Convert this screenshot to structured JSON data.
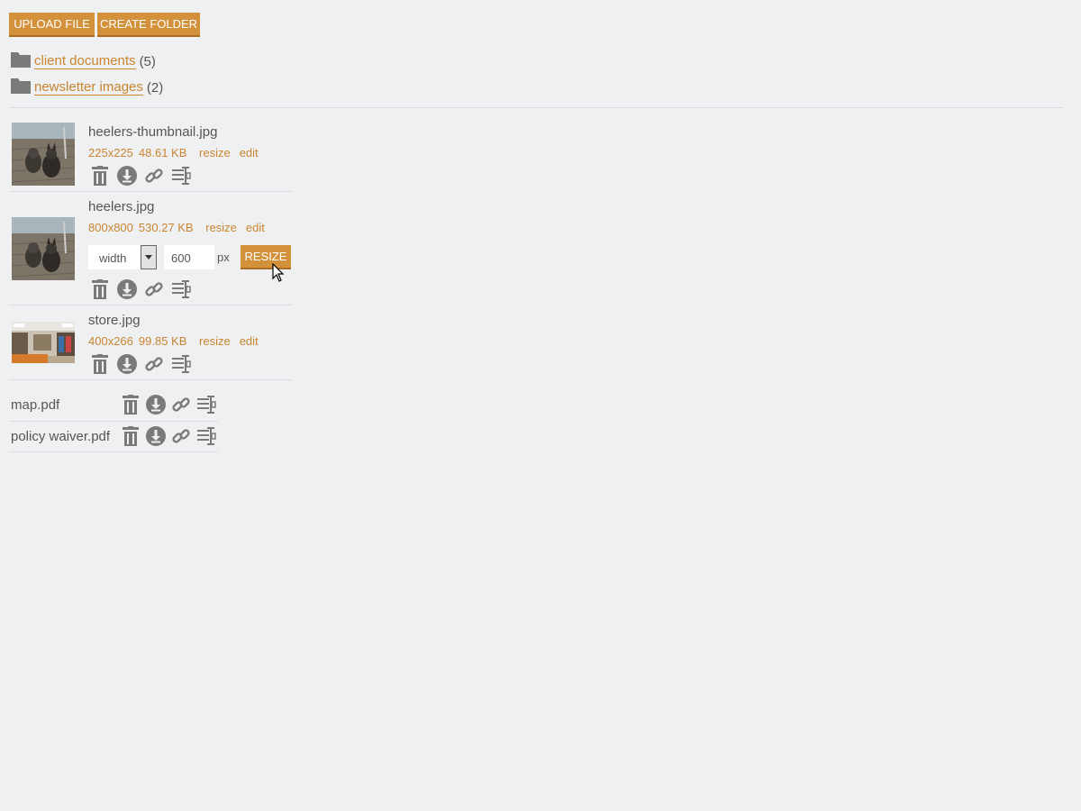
{
  "toolbar": {
    "upload_label": "UPLOAD FILE",
    "create_folder_label": "CREATE FOLDER"
  },
  "folders": [
    {
      "name": "client documents",
      "count": "(5)"
    },
    {
      "name": "newsletter images",
      "count": "(2)"
    }
  ],
  "images": [
    {
      "name": "heelers-thumbnail.jpg",
      "dimensions": "225x225",
      "size": "48.61 KB",
      "resize": "resize",
      "edit": "edit"
    },
    {
      "name": "heelers.jpg",
      "dimensions": "800x800",
      "size": "530.27 KB",
      "resize": "resize",
      "edit": "edit"
    },
    {
      "name": "store.jpg",
      "dimensions": "400x266",
      "size": "99.85 KB",
      "resize": "resize",
      "edit": "edit"
    }
  ],
  "resize_form": {
    "dimension_selected": "width",
    "value": "600",
    "unit": "px",
    "button_label": "RESIZE"
  },
  "documents": [
    {
      "name": "map.pdf"
    },
    {
      "name": "policy waiver.pdf"
    }
  ],
  "icons": [
    "trash-icon",
    "download-icon",
    "link-icon",
    "insert-icon"
  ],
  "colors": {
    "accent": "#d3913c",
    "link": "#c9852f",
    "icon": "#7a7a7a",
    "background": "#eff0f2"
  }
}
